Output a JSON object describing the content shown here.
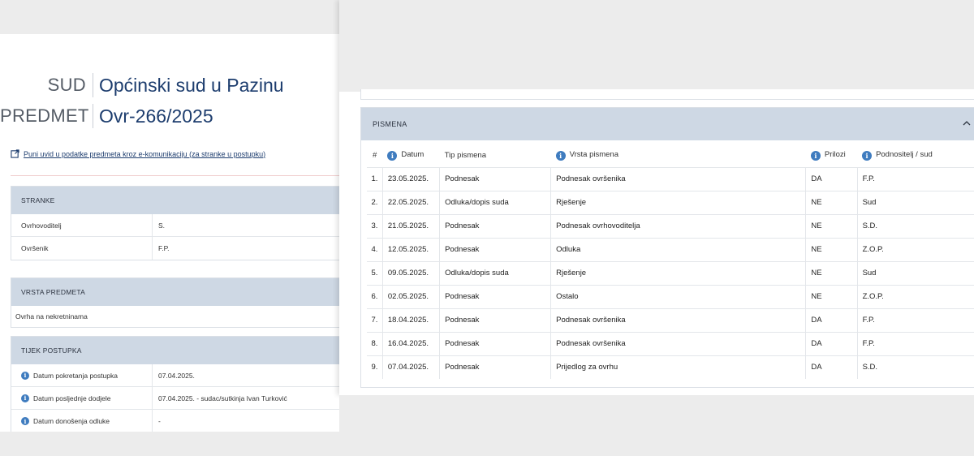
{
  "header": {
    "court_label": "SUD",
    "court_value": "Općinski sud u Pazinu",
    "case_label": "PREDMET",
    "case_value": "Ovr-266/2025",
    "full_access_link": "Puni uvid u podatke predmeta kroz e-komunikaciju (za stranke u postupku)"
  },
  "stranke": {
    "title": "STRANKE",
    "rows": [
      {
        "key": "Ovrhovoditelj",
        "value": "S."
      },
      {
        "key": "Ovršenik",
        "value": "F.P."
      }
    ]
  },
  "vrsta_predmeta": {
    "title": "VRSTA PREDMETA",
    "value": "Ovrha na nekretninama"
  },
  "tijek_postupka": {
    "title": "TIJEK POSTUPKA",
    "rows": [
      {
        "key": "Datum pokretanja postupka",
        "value": "07.04.2025."
      },
      {
        "key": "Datum posljednje dodjele",
        "value": "07.04.2025. - sudac/sutkinja Ivan Turković"
      },
      {
        "key": "Datum donošenja odluke",
        "value": "-"
      }
    ]
  },
  "pismena": {
    "title": "PISMENA",
    "columns": [
      "#",
      "Datum",
      "Tip pismena",
      "Vrsta pismena",
      "Prilozi",
      "Podnositelj / sud"
    ],
    "rows": [
      [
        "1.",
        "23.05.2025.",
        "Podnesak",
        "Podnesak ovršenika",
        "DA",
        "F.P."
      ],
      [
        "2.",
        "22.05.2025.",
        "Odluka/dopis suda",
        "Rješenje",
        "NE",
        "Sud"
      ],
      [
        "3.",
        "21.05.2025.",
        "Podnesak",
        "Podnesak ovrhovoditelja",
        "NE",
        "S.D."
      ],
      [
        "4.",
        "12.05.2025.",
        "Podnesak",
        "Odluka",
        "NE",
        "Z.O.P."
      ],
      [
        "5.",
        "09.05.2025.",
        "Odluka/dopis suda",
        "Rješenje",
        "NE",
        "Sud"
      ],
      [
        "6.",
        "02.05.2025.",
        "Podnesak",
        "Ostalo",
        "NE",
        "Z.O.P."
      ],
      [
        "7.",
        "18.04.2025.",
        "Podnesak",
        "Podnesak ovršenika",
        "DA",
        "F.P."
      ],
      [
        "8.",
        "16.04.2025.",
        "Podnesak",
        "Podnesak ovršenika",
        "DA",
        "F.P."
      ],
      [
        "9.",
        "07.04.2025.",
        "Podnesak",
        "Prijedlog za ovrhu",
        "DA",
        "S.D."
      ]
    ]
  },
  "icons": {
    "info": "info-icon",
    "external_link": "external-link-icon",
    "collapse": "chevron-up-icon"
  },
  "colors": {
    "header_bg": "#ced8e4",
    "title_blue": "#1d3d6e",
    "info_blue": "#3f7cbf"
  }
}
